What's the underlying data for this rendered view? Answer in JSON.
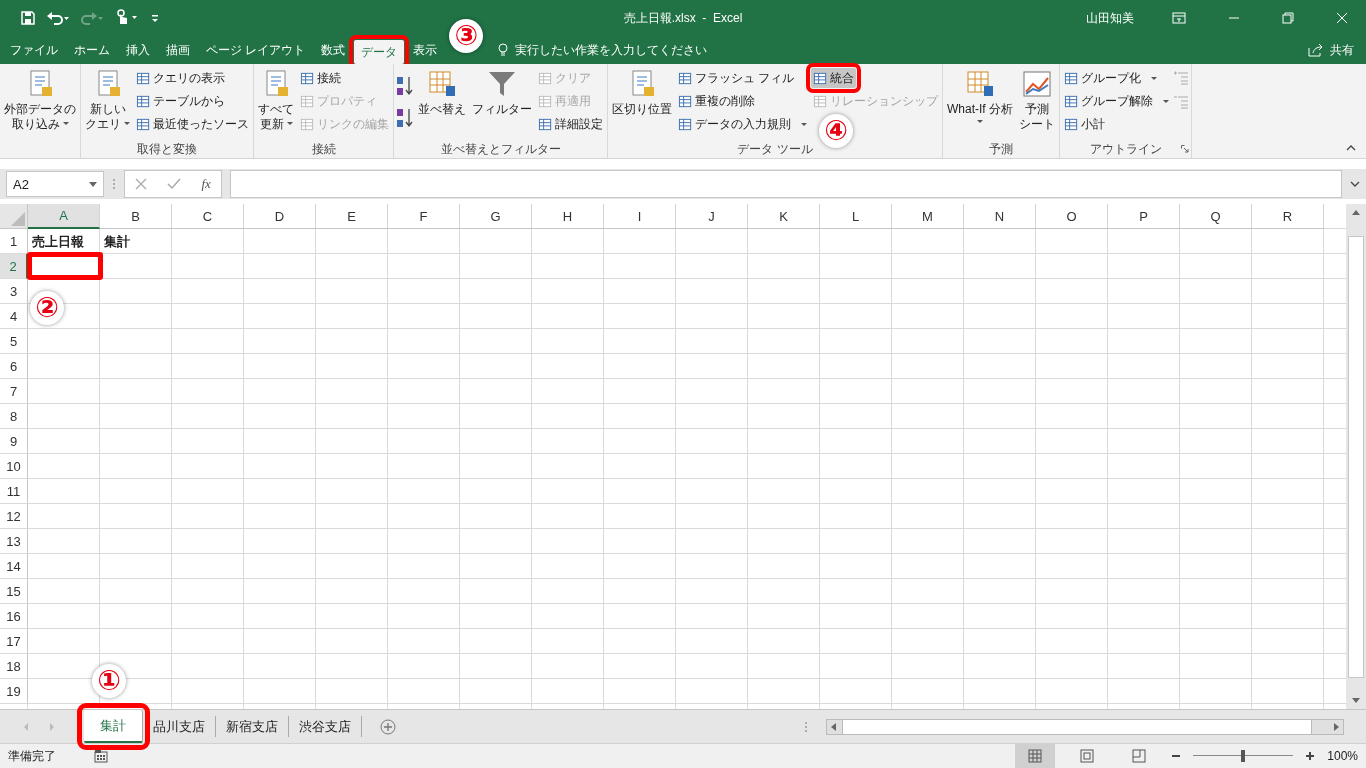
{
  "title_bar": {
    "title": "売上日報.xlsx  -  Excel",
    "user": "山田知美"
  },
  "tabs": [
    {
      "label": "ファイル",
      "selected": false,
      "highlighted": false
    },
    {
      "label": "ホーム",
      "selected": false,
      "highlighted": false
    },
    {
      "label": "挿入",
      "selected": false,
      "highlighted": false
    },
    {
      "label": "描画",
      "selected": false,
      "highlighted": false
    },
    {
      "label": "ページ レイアウト",
      "selected": false,
      "highlighted": false
    },
    {
      "label": "数式",
      "selected": false,
      "highlighted": false
    },
    {
      "label": "データ",
      "selected": true,
      "highlighted": true
    },
    {
      "label": "表示",
      "selected": false,
      "highlighted": false
    }
  ],
  "tell_me": "実行したい作業を入力してください",
  "share": "共有",
  "ribbon": [
    {
      "columns": [
        {
          "kind": "large",
          "lines": [
            "外部データの",
            "取り込み"
          ],
          "dropdown": true
        }
      ]
    },
    {
      "label": "取得と変換",
      "columns": [
        {
          "kind": "large",
          "lines": [
            "新しい",
            "クエリ"
          ],
          "dropdown": true
        },
        {
          "kind": "stack",
          "items": [
            {
              "label": "クエリの表示",
              "disabled": false,
              "dropdown": false,
              "highlighted": false
            },
            {
              "label": "テーブルから",
              "disabled": false,
              "dropdown": false,
              "highlighted": false
            },
            {
              "label": "最近使ったソース",
              "disabled": false,
              "dropdown": false,
              "highlighted": false
            }
          ]
        }
      ]
    },
    {
      "label": "接続",
      "columns": [
        {
          "kind": "large",
          "lines": [
            "すべて",
            "更新"
          ],
          "dropdown": true
        },
        {
          "kind": "stack",
          "items": [
            {
              "label": "接続",
              "disabled": false,
              "dropdown": false,
              "highlighted": false
            },
            {
              "label": "プロパティ",
              "disabled": true,
              "dropdown": false,
              "highlighted": false
            },
            {
              "label": "リンクの編集",
              "disabled": true,
              "dropdown": false,
              "highlighted": false
            }
          ]
        }
      ]
    },
    {
      "label": "並べ替えとフィルター",
      "columns": [
        {
          "kind": "sort"
        },
        {
          "kind": "large",
          "lines": [
            "並べ替え"
          ],
          "dropdown": false
        },
        {
          "kind": "large",
          "lines": [
            "フィルター"
          ],
          "dropdown": false
        },
        {
          "kind": "stack",
          "items": [
            {
              "label": "クリア",
              "disabled": true,
              "dropdown": false,
              "highlighted": false
            },
            {
              "label": "再適用",
              "disabled": true,
              "dropdown": false,
              "highlighted": false
            },
            {
              "label": "詳細設定",
              "disabled": false,
              "dropdown": false,
              "highlighted": false
            }
          ]
        }
      ]
    },
    {
      "label": "データ ツール",
      "columns": [
        {
          "kind": "large",
          "lines": [
            "区切り位置"
          ],
          "dropdown": false
        },
        {
          "kind": "stack",
          "items": [
            {
              "label": "フラッシュ フィル",
              "disabled": false,
              "dropdown": false,
              "highlighted": false
            },
            {
              "label": "重複の削除",
              "disabled": false,
              "dropdown": false,
              "highlighted": false
            },
            {
              "label": "データの入力規則",
              "disabled": false,
              "dropdown": true,
              "highlighted": false
            }
          ]
        },
        {
          "kind": "stack",
          "items": [
            {
              "label": "統合",
              "disabled": false,
              "dropdown": false,
              "highlighted": true
            },
            {
              "label": "リレーションシップ",
              "disabled": true,
              "dropdown": false,
              "highlighted": false
            }
          ]
        }
      ]
    },
    {
      "label": "予測",
      "columns": [
        {
          "kind": "large",
          "lines": [
            "What-If 分析"
          ],
          "dropdown": true
        },
        {
          "kind": "large",
          "lines": [
            "予測",
            "シート"
          ],
          "dropdown": false
        }
      ]
    },
    {
      "label": "アウトライン",
      "launcher": true,
      "columns": [
        {
          "kind": "stack",
          "items": [
            {
              "label": "グループ化",
              "disabled": false,
              "dropdown": true,
              "highlighted": false
            },
            {
              "label": "グループ解除",
              "disabled": false,
              "dropdown": true,
              "highlighted": false
            },
            {
              "label": "小計",
              "disabled": false,
              "dropdown": false,
              "highlighted": false
            }
          ]
        },
        {
          "kind": "icons"
        }
      ]
    }
  ],
  "formula_bar": {
    "name_box": "A2",
    "function_label": "fx"
  },
  "grid": {
    "columns": [
      {
        "label": "A",
        "selected": true
      },
      {
        "label": "B",
        "selected": false
      },
      {
        "label": "C",
        "selected": false
      },
      {
        "label": "D",
        "selected": false
      },
      {
        "label": "E",
        "selected": false
      },
      {
        "label": "F",
        "selected": false
      },
      {
        "label": "G",
        "selected": false
      },
      {
        "label": "H",
        "selected": false
      },
      {
        "label": "I",
        "selected": false
      },
      {
        "label": "J",
        "selected": false
      },
      {
        "label": "K",
        "selected": false
      },
      {
        "label": "L",
        "selected": false
      },
      {
        "label": "M",
        "selected": false
      },
      {
        "label": "N",
        "selected": false
      },
      {
        "label": "O",
        "selected": false
      },
      {
        "label": "P",
        "selected": false
      },
      {
        "label": "Q",
        "selected": false
      },
      {
        "label": "R",
        "selected": false
      }
    ],
    "rows": [
      {
        "label": "1",
        "selected": false,
        "values": [
          "売上日報",
          "集計"
        ]
      },
      {
        "label": "2",
        "selected": true,
        "highlighted": true
      },
      {
        "label": "3",
        "selected": false
      },
      {
        "label": "4",
        "selected": false
      },
      {
        "label": "5",
        "selected": false
      },
      {
        "label": "6",
        "selected": false
      },
      {
        "label": "7",
        "selected": false
      },
      {
        "label": "8",
        "selected": false
      },
      {
        "label": "9",
        "selected": false
      },
      {
        "label": "10",
        "selected": false
      },
      {
        "label": "11",
        "selected": false
      },
      {
        "label": "12",
        "selected": false
      },
      {
        "label": "13",
        "selected": false
      },
      {
        "label": "14",
        "selected": false
      },
      {
        "label": "15",
        "selected": false
      },
      {
        "label": "16",
        "selected": false
      },
      {
        "label": "17",
        "selected": false
      },
      {
        "label": "18",
        "selected": false
      },
      {
        "label": "19",
        "selected": false
      }
    ]
  },
  "sheet_tabs": [
    {
      "label": "集計",
      "selected": true,
      "highlighted": true
    },
    {
      "label": "品川支店",
      "selected": false,
      "highlighted": false
    },
    {
      "label": "新宿支店",
      "selected": false,
      "highlighted": false
    },
    {
      "label": "渋谷支店",
      "selected": false,
      "highlighted": false
    }
  ],
  "status_bar": {
    "status": "準備完了",
    "zoom": "100%",
    "zoom_slider": {
      "level": 0.5
    },
    "views": [
      {
        "selected": true
      },
      {
        "selected": false
      },
      {
        "selected": false
      }
    ]
  },
  "annotations": [
    {
      "label": "①"
    },
    {
      "label": "②"
    },
    {
      "label": "③"
    },
    {
      "label": "④"
    }
  ]
}
